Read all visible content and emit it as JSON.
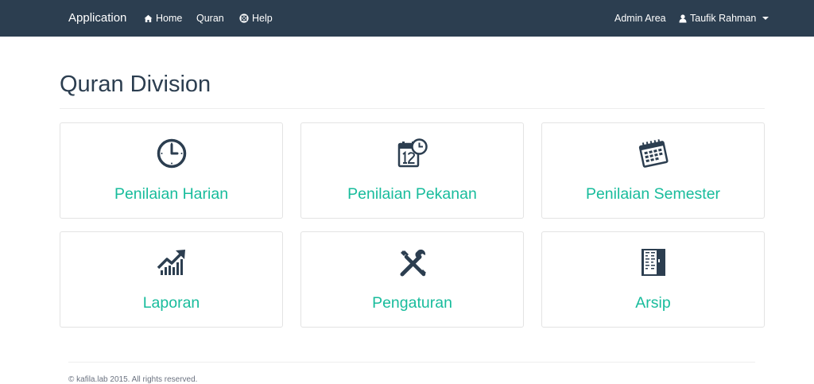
{
  "navbar": {
    "brand": "Application",
    "links": [
      {
        "label": "Home",
        "icon": "home-icon"
      },
      {
        "label": "Quran"
      },
      {
        "label": "Help",
        "icon": "life-ring-icon"
      }
    ],
    "admin_area": "Admin Area",
    "user_name": "Taufik Rahman",
    "user_icon": "user-icon"
  },
  "page": {
    "title": "Quran Division"
  },
  "cards": [
    {
      "label": "Penilaian Harian",
      "icon": "clock-icon"
    },
    {
      "label": "Penilaian Pekanan",
      "icon": "calendar-clock-icon"
    },
    {
      "label": "Penilaian Semester",
      "icon": "calendar-icon"
    },
    {
      "label": "Laporan",
      "icon": "chart-growth-icon"
    },
    {
      "label": "Pengaturan",
      "icon": "tools-icon"
    },
    {
      "label": "Arsip",
      "icon": "archive-cabinet-icon"
    }
  ],
  "footer": {
    "text": "© kafila.lab 2015. All rights reserved."
  },
  "colors": {
    "navbar_bg": "#2c3e50",
    "accent": "#18bc9c",
    "text_dark": "#2c3e50"
  }
}
